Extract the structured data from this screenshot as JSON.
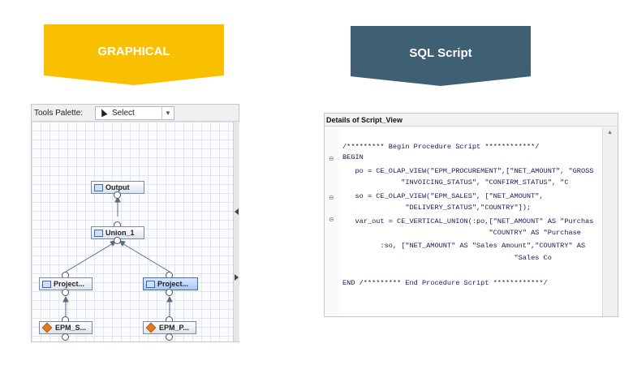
{
  "banners": {
    "graphical": "GRAPHICAL",
    "sql": "SQL Script"
  },
  "colors": {
    "graphical_banner": "#f9c000",
    "sql_banner": "#3f5f72",
    "code_text": "#1a1a55"
  },
  "left_editor": {
    "palette_label": "Tools Palette:",
    "select_value": "Select",
    "nodes": {
      "output": "Output",
      "union": "Union_1",
      "project_left": "Project...",
      "project_right": "Project...",
      "epm_left": "EPM_S...",
      "epm_right": "EPM_P..."
    }
  },
  "right_panel": {
    "title": "Details of Script_View",
    "code_lines": [
      "/********* Begin Procedure Script ************/",
      "BEGIN",
      "   po = CE_OLAP_VIEW(\"EPM_PROCUREMENT\",[\"NET_AMOUNT\", \"GROSS",
      "              \"INVOICING_STATUS\", \"CONFIRM_STATUS\", \"C",
      "   so = CE_OLAP_VIEW(\"EPM_SALES\", [\"NET_AMOUNT\",",
      "               \"DELIVERY_STATUS\",\"COUNTRY\"]);",
      "   var_out = CE_VERTICAL_UNION(:po,[\"NET_AMOUNT\" AS \"Purchas",
      "                                   \"COUNTRY\" AS \"Purchase",
      "         :so, [\"NET_AMOUNT\" AS \"Sales Amount\",\"COUNTRY\" AS",
      "                                         \"Sales Co",
      "",
      "END /********* End Procedure Script ************/"
    ]
  }
}
